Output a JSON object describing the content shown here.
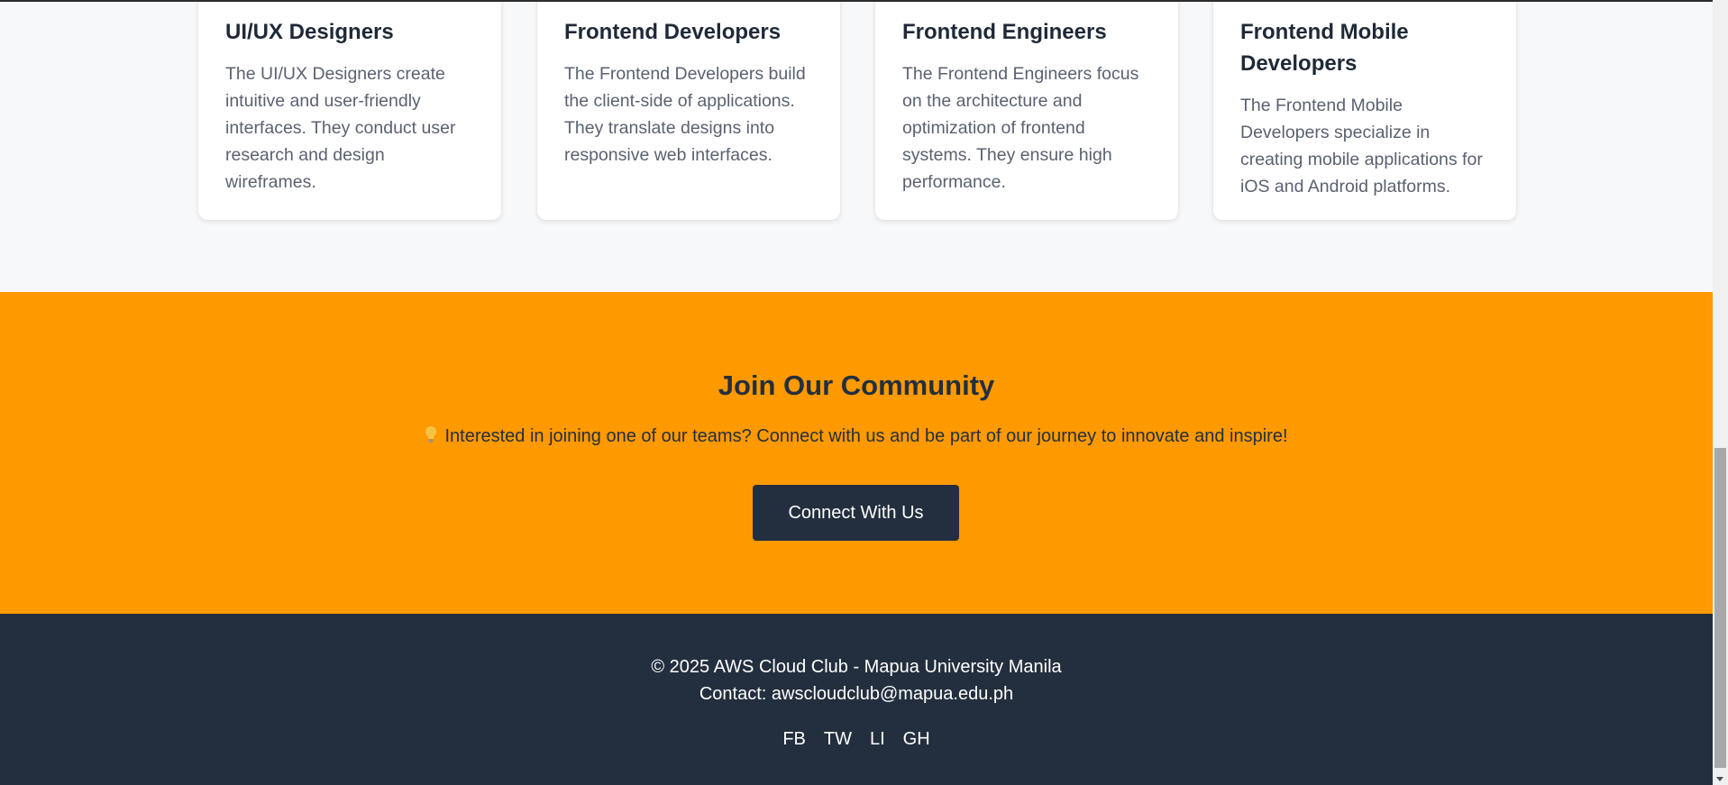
{
  "roles": [
    {
      "title": "UI/UX Designers",
      "description": "The UI/UX Designers create intuitive and user-friendly interfaces. They conduct user research and design wireframes."
    },
    {
      "title": "Frontend Developers",
      "description": "The Frontend Developers build the client-side of applications. They translate designs into responsive web interfaces."
    },
    {
      "title": "Frontend Engineers",
      "description": "The Frontend Engineers focus on the architecture and optimization of frontend systems. They ensure high performance."
    },
    {
      "title": "Frontend Mobile Developers",
      "description": "The Frontend Mobile Developers specialize in creating mobile applications for iOS and Android platforms."
    }
  ],
  "community": {
    "heading": "Join Our Community",
    "icon": "lightbulb-icon",
    "subtitle": "Interested in joining one of our teams? Connect with us and be part of our journey to innovate and inspire!",
    "button_label": "Connect With Us"
  },
  "footer": {
    "copyright": "© 2025 AWS Cloud Club - Mapua University Manila",
    "contact": "Contact: awscloudclub@mapua.edu.ph",
    "socials": [
      "FB",
      "TW",
      "LI",
      "GH"
    ]
  },
  "colors": {
    "accent": "#ff9900",
    "dark": "#232f3e",
    "background": "#f7f8fa"
  }
}
